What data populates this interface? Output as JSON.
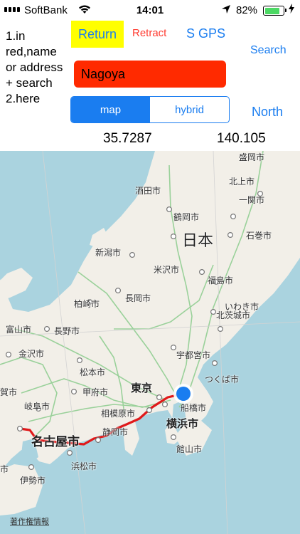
{
  "status_bar": {
    "carrier": "SoftBank",
    "time": "14:01",
    "battery_percent": "82%",
    "battery_level": 0.82
  },
  "instructions": "1.in red,name or address + search 2.here",
  "buttons": {
    "return": "Return",
    "retract": "Retract",
    "sgps": "S GPS",
    "search": "Search",
    "north": "North"
  },
  "search_input": {
    "value": "Nagoya",
    "placeholder": ""
  },
  "map_type": {
    "options": [
      "map",
      "hybrid"
    ],
    "selected": "map"
  },
  "coordinates": {
    "lat": "35.7287",
    "lon": "140.105"
  },
  "map": {
    "attribution": "著作権情報",
    "labels": {
      "morioka": "盛岡市",
      "sakata": "酒田市",
      "kitakami": "北上市",
      "ichinoseki": "一関市",
      "tsuruoka": "鶴岡市",
      "nihon": "日本",
      "ishinomaki": "石巻市",
      "niigata": "新潟市",
      "yonezawa": "米沢市",
      "fukushima": "福島市",
      "kashiwazaki": "柏崎市",
      "nagaoka": "長岡市",
      "iwaki": "いわき市",
      "toyama": "富山市",
      "nagano": "長野市",
      "kitaibaraki": "北茨城市",
      "kanazawa": "金沢市",
      "utsunomiya": "宇都宮市",
      "matsumoto": "松本市",
      "tsukuba": "つくば市",
      "kofu": "甲府市",
      "tokyo": "東京",
      "gifu": "岐阜市",
      "sagamihara": "相模原市",
      "funabashi": "船橋市",
      "yokohama": "横浜市",
      "nagoya": "名古屋市",
      "shizuoka": "静岡市",
      "tateyama": "館山市",
      "hamamatsu": "浜松市",
      "ise": "伊勢市",
      "partial_left": "賀市",
      "partial_bottom_left": "市"
    }
  }
}
